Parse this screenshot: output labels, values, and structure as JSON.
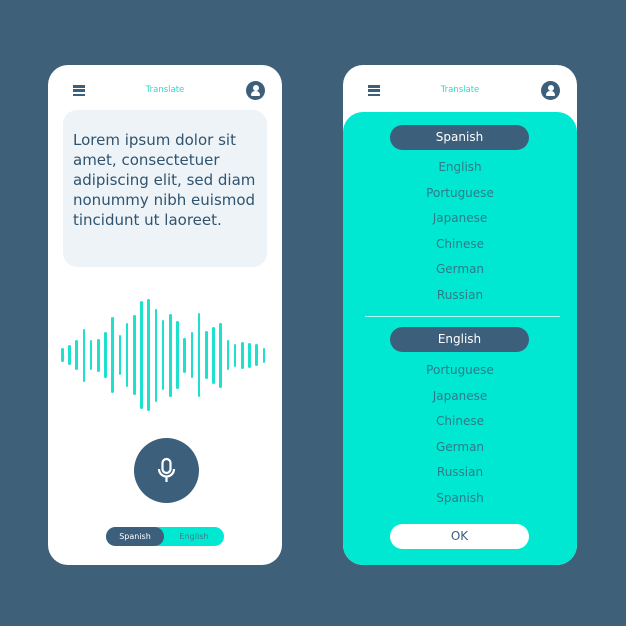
{
  "colors": {
    "background": "#3f6079",
    "accent": "#00e8d2",
    "dark": "#3c5f7c"
  },
  "left_phone": {
    "title": "Translate",
    "text": "Lorem ipsum dolor sit amet, consectetuer adipiscing elit, sed diam nonummy nibh euismod tincidunt ut laoreet.",
    "mic_icon": "microphone-icon",
    "toggle": {
      "source": "Spanish",
      "target": "English"
    }
  },
  "right_phone": {
    "title": "Translate",
    "source_selected": "Spanish",
    "source_options": [
      "English",
      "Portuguese",
      "Japanese",
      "Chinese",
      "German",
      "Russian"
    ],
    "target_selected": "English",
    "target_options": [
      "Portuguese",
      "Japanese",
      "Chinese",
      "German",
      "Russian",
      "Spanish"
    ],
    "ok_label": "OK"
  }
}
